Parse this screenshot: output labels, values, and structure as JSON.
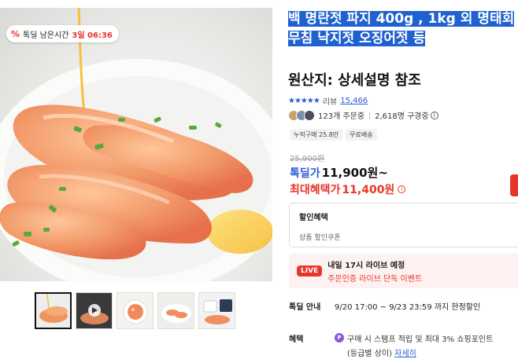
{
  "badge": {
    "icon": "percent-icon",
    "label": "톡딜 남은시간",
    "time": "3일 06:36"
  },
  "product": {
    "title": "백 명란젓 파지 400g , 1kg 외 명태회무침 낙지젓 오징어젓 등",
    "origin": "원산지: 상세설명 참조",
    "rating": {
      "stars": 4.5,
      "review_label": "리뷰",
      "review_count": "15,466"
    },
    "buyers": {
      "orders": "123개 주문중",
      "subscribers": "2,618명 구경중"
    },
    "tags": [
      "누적구매 25.8만",
      "무료배송"
    ],
    "original_price": "25,900원",
    "price_label": "톡딜가",
    "price": "11,900원~",
    "max_label": "최대혜택가",
    "max_price": "11,400원"
  },
  "discount": {
    "heading": "할인혜택",
    "sub": "상품 할인쿠폰"
  },
  "live": {
    "badge": "LIVE",
    "line1": "내일 17시 라이브 예정",
    "line2": "주문인증 라이브 단독 이벤트"
  },
  "deal": {
    "label": "톡딜 안내",
    "text": "9/20 17:00 ~ 9/23 23:59 까지 한정할인"
  },
  "benefit": {
    "label": "혜택",
    "icon": "P",
    "line1": "구매 시 스탬프 적립 및 최대 3% 쇼핑포인트",
    "line2": "(등급별 상이)",
    "link": "자세히"
  },
  "colors": {
    "accent_blue": "#2e5bd3",
    "accent_red": "#e8352b",
    "selection": "#1f62cf"
  },
  "thumbnails": [
    "thumb-roe-main",
    "thumb-video",
    "thumb-bowl",
    "thumb-plate",
    "thumb-package"
  ]
}
